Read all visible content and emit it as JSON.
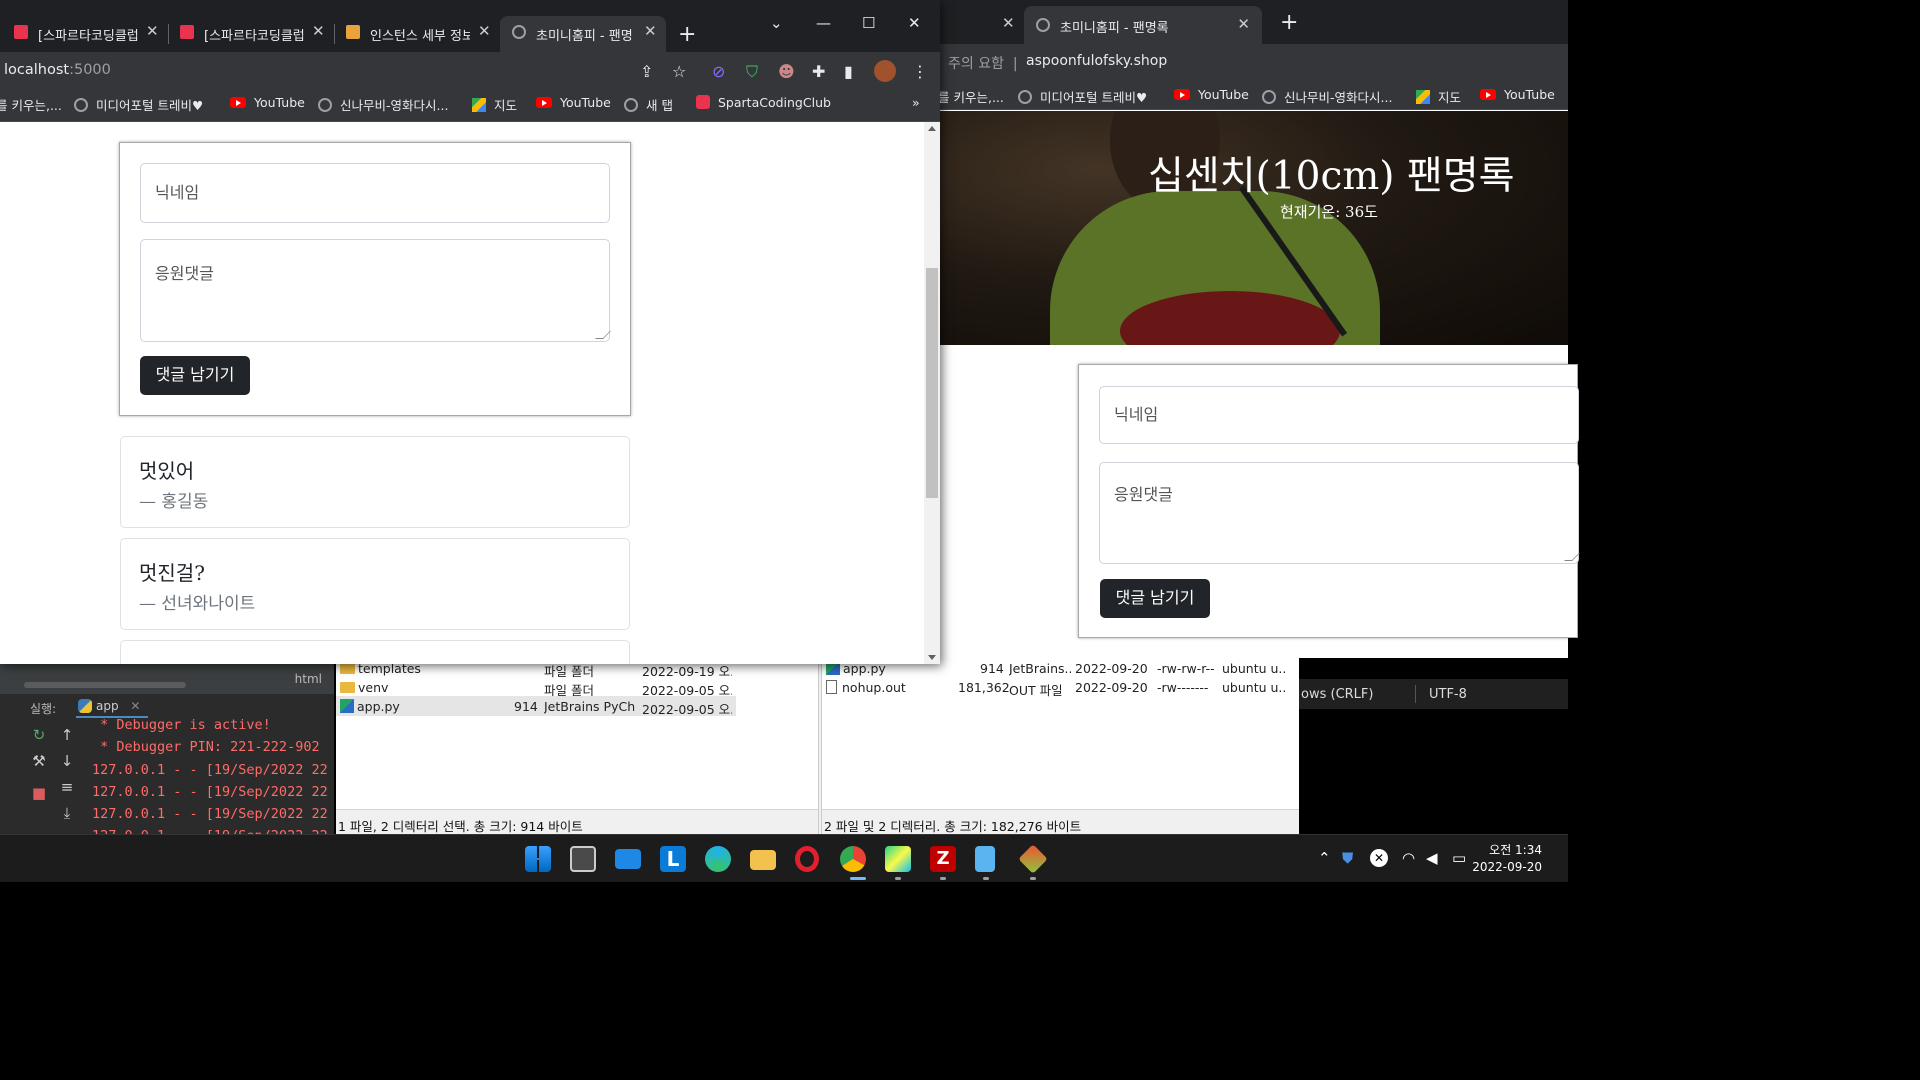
{
  "left_browser": {
    "tabs": [
      {
        "title": "[스파르타코딩클럽",
        "active": false
      },
      {
        "title": "[스파르타코딩클럽",
        "active": false
      },
      {
        "title": "인스턴스 세부 정보",
        "active": false
      },
      {
        "title": "초미니홈피 - 팬명",
        "active": true
      }
    ],
    "url_host": "localhost",
    "url_port": ":5000",
    "bookmarks": [
      "를 키우는,...",
      "미디어포털 트레비♥",
      "YouTube",
      "신나무비-영화다시...",
      "지도",
      "YouTube",
      "새 탭",
      "SpartaCodingClub"
    ],
    "bookmarks_more": "»",
    "form": {
      "nickname_placeholder": "닉네임",
      "comment_placeholder": "응원댓글",
      "submit_label": "댓글 남기기"
    },
    "comments": [
      {
        "message": "멋있어",
        "author": "— 홍길동"
      },
      {
        "message": "멋진걸?",
        "author": "— 선녀와나이트"
      }
    ]
  },
  "right_browser": {
    "tab_title": "초미니홈피 - 팬명록",
    "security_warning": "주의 요함",
    "url": "aspoonfulofsky.shop",
    "bookmarks": [
      "를 키우는,...",
      "미디어포털 트레비♥",
      "YouTube",
      "신나무비-영화다시...",
      "지도",
      "YouTube"
    ],
    "page_title": "십센치(10cm) 팬명록",
    "temperature": "현재기온: 36도",
    "form": {
      "nickname_placeholder": "닉네임",
      "comment_placeholder": "응원댓글",
      "submit_label": "댓글 남기기"
    }
  },
  "pycharm": {
    "editor_tab": "html",
    "run_label": "실행:",
    "run_config": "app",
    "console_lines": [
      " * Debugger is active!",
      " * Debugger PIN: 221-222-902",
      "127.0.0.1 - - [19/Sep/2022 22",
      "127.0.0.1 - - [19/Sep/2022 22",
      "127.0.0.1 - - [19/Sep/2022 22",
      "127.0.0.1 - - [19/Sep/2022 22"
    ]
  },
  "filezilla_local": {
    "rows": [
      {
        "name": "templates",
        "size": "",
        "type": "파일 폴더",
        "date": "2022-09-19 오...",
        "icon": "folder"
      },
      {
        "name": "venv",
        "size": "",
        "type": "파일 폴더",
        "date": "2022-09-05 오...",
        "icon": "folder"
      },
      {
        "name": "app.py",
        "size": "914",
        "type": "JetBrains PyCh...",
        "date": "2022-09-05 오...",
        "icon": "python",
        "selected": true
      }
    ],
    "status": "1 파일, 2 디렉터리 선택. 총 크기: 914 바이트"
  },
  "filezilla_remote": {
    "rows": [
      {
        "name": "app.py",
        "size": "914",
        "type": "JetBrains...",
        "date": "2022-09-20...",
        "perm": "-rw-rw-r--",
        "owner": "ubuntu u..."
      },
      {
        "name": "nohup.out",
        "size": "181,362",
        "type": "OUT 파일",
        "date": "2022-09-20...",
        "perm": "-rw-------",
        "owner": "ubuntu u..."
      }
    ],
    "status": "2 파일 및 2 디렉터리. 총 크기: 182,276 바이트"
  },
  "notepad_status": {
    "line_ending": "ows (CRLF)",
    "encoding": "UTF-8"
  },
  "taskbar": {
    "time": "오전 1:34",
    "date": "2022-09-20",
    "apps": [
      "start",
      "widgets",
      "mail",
      "l-app",
      "edge",
      "file-explorer",
      "opera",
      "chrome",
      "pycharm",
      "filezilla",
      "notepad",
      "git"
    ]
  },
  "colors": {
    "dark_button": "#212529",
    "chrome_dark": "#35363a",
    "console_red": "#ff6b68"
  }
}
